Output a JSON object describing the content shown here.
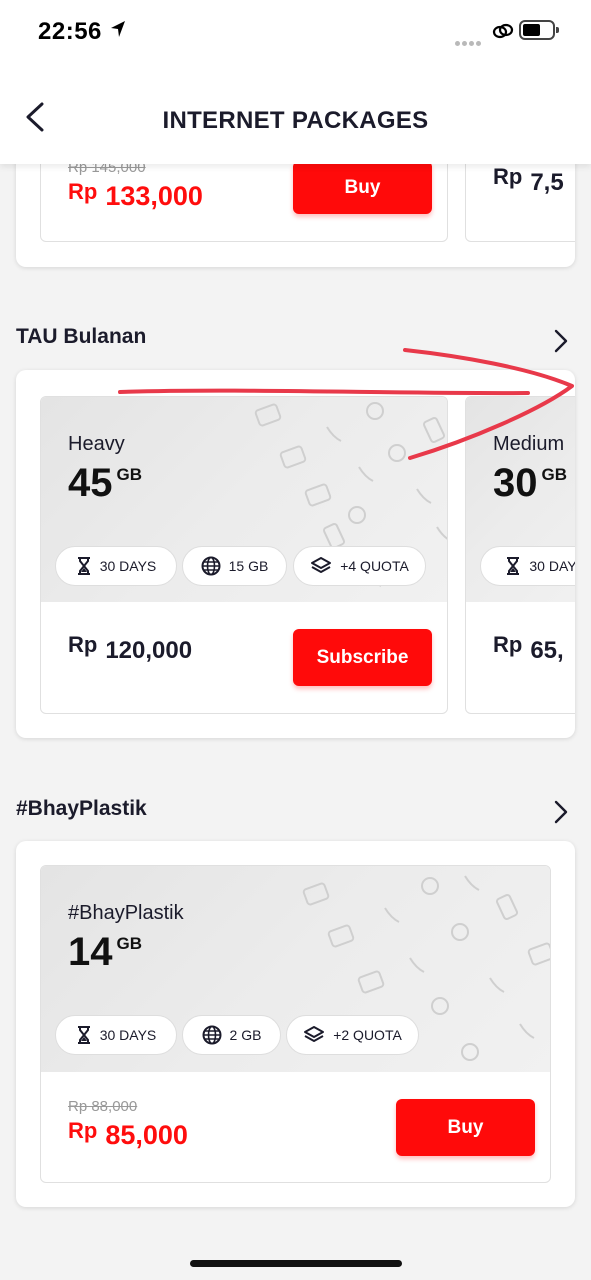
{
  "status_bar": {
    "time": "22:56"
  },
  "header": {
    "title": "INTERNET PACKAGES"
  },
  "top_section": {
    "old_price": "Rp 145,000",
    "price": "133,000",
    "currency": "Rp",
    "buy_label": "Buy",
    "next_price_partial": "7,5"
  },
  "tau_section": {
    "title": "TAU Bulanan",
    "packages": [
      {
        "name": "Heavy",
        "quota": "45",
        "unit": "GB",
        "chips": [
          "30 DAYS",
          "15 GB",
          "+4 QUOTA"
        ],
        "currency": "Rp",
        "price": "120,000",
        "button": "Subscribe"
      },
      {
        "name": "Medium",
        "quota": "30",
        "unit": "GB",
        "chips": [
          "30 DAY"
        ],
        "currency": "Rp",
        "price": "65,"
      }
    ]
  },
  "bhay_section": {
    "title": "#BhayPlastik",
    "package": {
      "name": "#BhayPlastik",
      "quota": "14",
      "unit": "GB",
      "chips": [
        "30 DAYS",
        "2 GB",
        "+2 QUOTA"
      ],
      "old_price": "Rp 88,000",
      "currency": "Rp",
      "price": "85,000",
      "button": "Buy"
    }
  },
  "colors": {
    "accent": "#ff0a0a",
    "annotation": "#e8394a"
  },
  "icons": [
    "back-chevron-icon",
    "location-arrow-icon",
    "link-icon",
    "battery-icon",
    "hourglass-icon",
    "globe-icon",
    "layers-icon",
    "chevron-right-icon"
  ]
}
